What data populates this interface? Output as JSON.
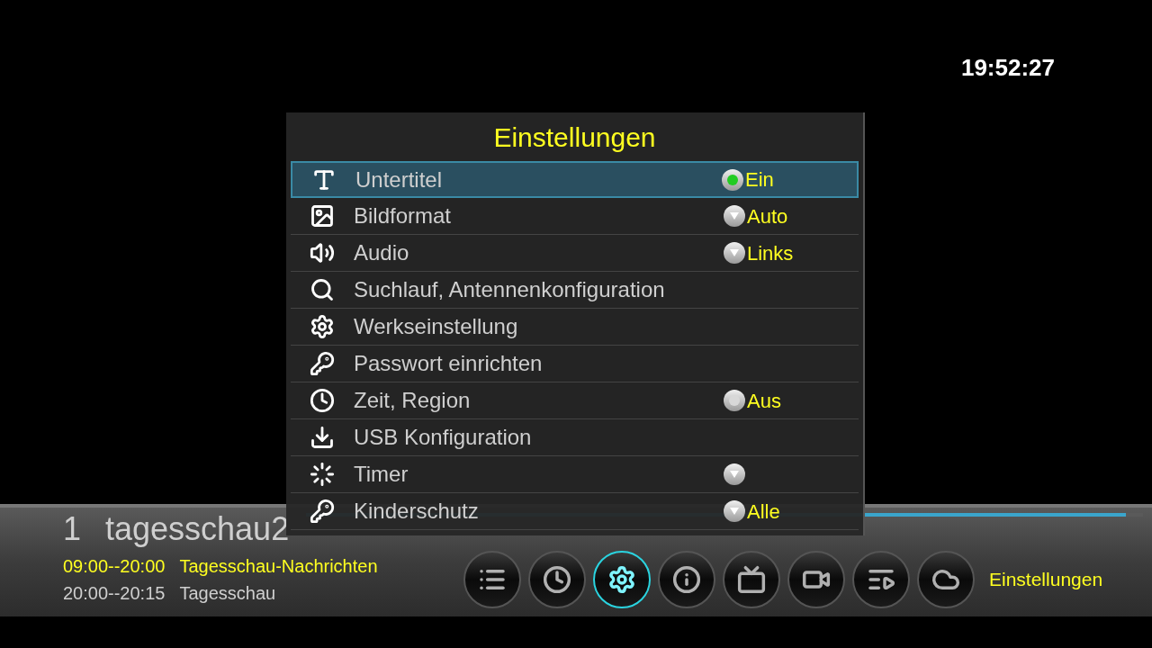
{
  "clock": "19:52:27",
  "menu": {
    "title": "Einstellungen",
    "items": [
      {
        "label": "Untertitel",
        "selected": true,
        "kind": "radio",
        "on": true,
        "value": "Ein"
      },
      {
        "label": "Bildformat",
        "selected": false,
        "kind": "dropdown",
        "value": "Auto"
      },
      {
        "label": "Audio",
        "selected": false,
        "kind": "dropdown",
        "value": "Links"
      },
      {
        "label": "Suchlauf, Antennenkonfiguration",
        "selected": false
      },
      {
        "label": "Werkseinstellung",
        "selected": false
      },
      {
        "label": "Passwort einrichten",
        "selected": false
      },
      {
        "label": "Zeit, Region",
        "selected": false,
        "kind": "radio",
        "on": false,
        "value": "Aus"
      },
      {
        "label": "USB Konfiguration",
        "selected": false
      },
      {
        "label": "Timer",
        "selected": false,
        "kind": "dropdown"
      },
      {
        "label": "Kinderschutz",
        "selected": false,
        "kind": "dropdown",
        "value": "Alle"
      }
    ]
  },
  "channel": {
    "number": "1",
    "name": "tagesschau2",
    "progress": {
      "level": 0.98
    },
    "programs": [
      {
        "time": "09:00--20:00",
        "title": "Tagesschau-Nachrichten",
        "current": true
      },
      {
        "time": "20:00--20:15",
        "title": "Tagesschau",
        "current": false
      }
    ]
  },
  "toolbar": {
    "buttons": [
      {
        "selected": false
      },
      {
        "selected": false
      },
      {
        "selected": true
      },
      {
        "selected": false
      },
      {
        "selected": false
      },
      {
        "selected": false
      },
      {
        "selected": false
      },
      {
        "selected": false
      }
    ],
    "label": "Einstellungen"
  }
}
